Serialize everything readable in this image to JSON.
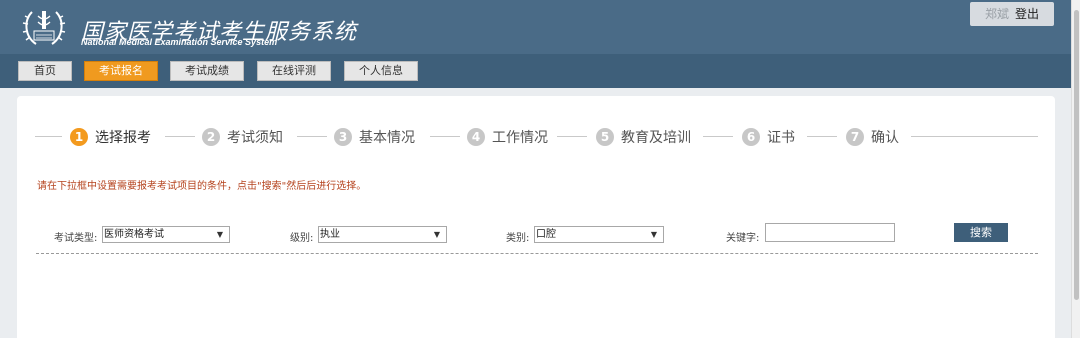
{
  "header": {
    "title_cn": "国家医学考试考生服务系统",
    "title_en": "National Medical Examination Service System",
    "user_name": "郑斌",
    "logout_label": "登出",
    "logo_icon": "medical-emblem-icon"
  },
  "nav": {
    "items": [
      {
        "label": "首页",
        "active": false
      },
      {
        "label": "考试报名",
        "active": true
      },
      {
        "label": "考试成绩",
        "active": false
      },
      {
        "label": "在线评测",
        "active": false
      },
      {
        "label": "个人信息",
        "active": false
      }
    ]
  },
  "steps": [
    {
      "num": "1",
      "label": "选择报考",
      "active": true
    },
    {
      "num": "2",
      "label": "考试须知",
      "active": false
    },
    {
      "num": "3",
      "label": "基本情况",
      "active": false
    },
    {
      "num": "4",
      "label": "工作情况",
      "active": false
    },
    {
      "num": "5",
      "label": "教育及培训",
      "active": false
    },
    {
      "num": "6",
      "label": "证书",
      "active": false
    },
    {
      "num": "7",
      "label": "确认",
      "active": false
    }
  ],
  "notice": "请在下拉框中设置需要报考考试项目的条件，点击\"搜索\"然后后进行选择。",
  "filters": {
    "exam_type": {
      "label": "考试类型:",
      "value": "医师资格考试"
    },
    "level": {
      "label": "级别:",
      "value": "执业"
    },
    "category": {
      "label": "类别:",
      "value": "口腔"
    },
    "keyword": {
      "label": "关键字:",
      "value": ""
    },
    "search_label": "搜索"
  },
  "colors": {
    "header_bg": "#4a6b87",
    "nav_bg": "#3e5f7a",
    "accent_orange": "#f39a1e",
    "notice_text": "#b5431e"
  }
}
